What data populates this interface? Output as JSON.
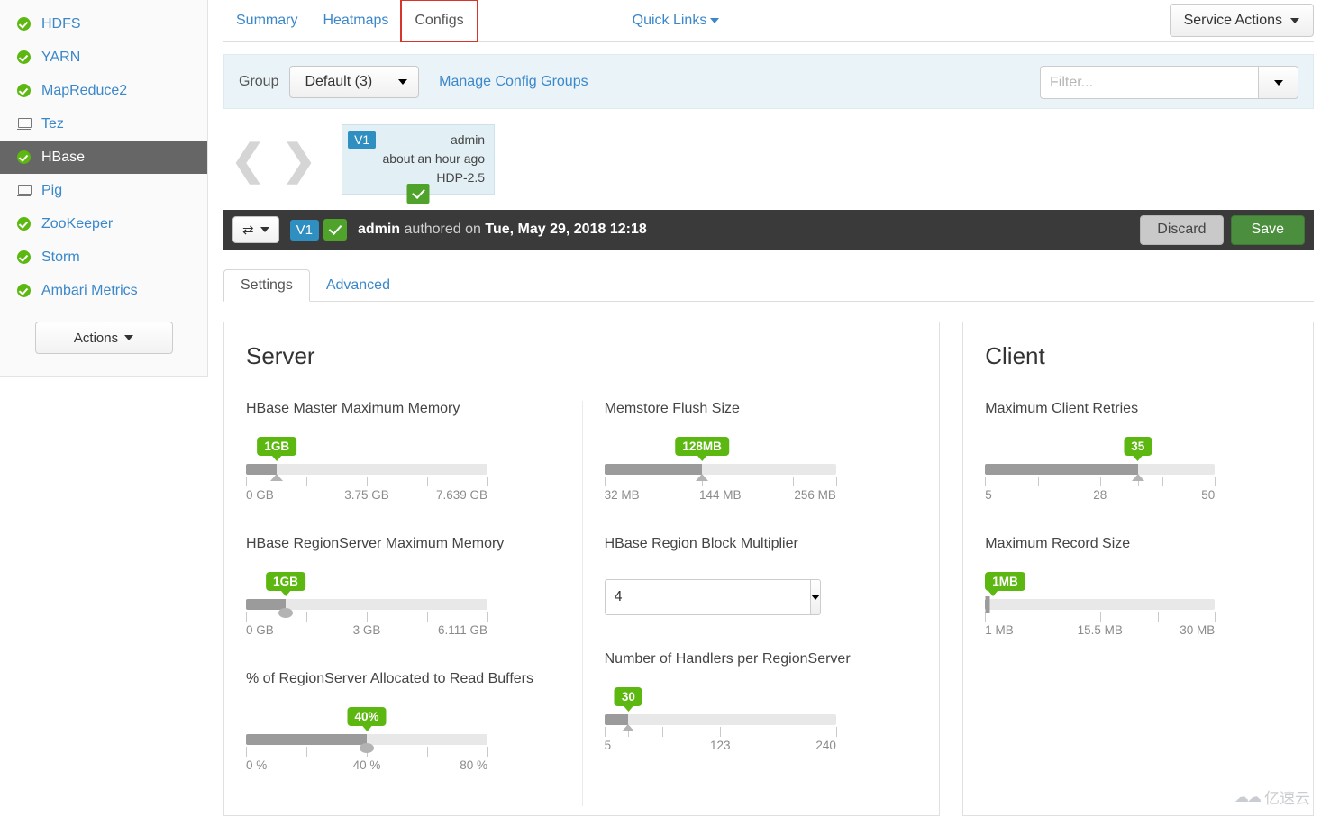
{
  "sidebar": {
    "services": [
      {
        "label": "HDFS",
        "icon": "status-ok-icon",
        "status": "ok",
        "active": false
      },
      {
        "label": "YARN",
        "icon": "status-ok-icon",
        "status": "ok",
        "active": false
      },
      {
        "label": "MapReduce2",
        "icon": "status-ok-icon",
        "status": "ok",
        "active": false
      },
      {
        "label": "Tez",
        "icon": "client-monitor-icon",
        "status": "client",
        "active": false
      },
      {
        "label": "HBase",
        "icon": "status-ok-icon",
        "status": "ok",
        "active": true
      },
      {
        "label": "Pig",
        "icon": "client-monitor-icon",
        "status": "client",
        "active": false
      },
      {
        "label": "ZooKeeper",
        "icon": "status-ok-icon",
        "status": "ok",
        "active": false
      },
      {
        "label": "Storm",
        "icon": "status-ok-icon",
        "status": "ok",
        "active": false
      },
      {
        "label": "Ambari Metrics",
        "icon": "status-ok-icon",
        "status": "ok",
        "active": false
      }
    ],
    "actions_button": "Actions"
  },
  "header": {
    "tabs": [
      {
        "label": "Summary",
        "selected": false
      },
      {
        "label": "Heatmaps",
        "selected": false
      },
      {
        "label": "Configs",
        "selected": true,
        "annotated": true
      }
    ],
    "quick_links": "Quick Links",
    "service_actions": "Service Actions"
  },
  "group_bar": {
    "group_label": "Group",
    "group_value": "Default (3)",
    "manage_link": "Manage Config Groups",
    "filter_placeholder": "Filter...",
    "filter_value": ""
  },
  "version_card": {
    "badge": "V1",
    "author": "admin",
    "time": "about an hour ago",
    "stack": "HDP-2.5",
    "current_icon": "check-icon"
  },
  "version_bar": {
    "compare_icon": "shuffle-icon",
    "badge": "V1",
    "check_icon": "check-icon",
    "author": "admin",
    "authored_text": "authored on",
    "timestamp": "Tue, May 29, 2018 12:18",
    "discard_label": "Discard",
    "save_label": "Save"
  },
  "config_tabs": [
    {
      "label": "Settings",
      "selected": true
    },
    {
      "label": "Advanced",
      "selected": false
    }
  ],
  "panels": {
    "server": {
      "title": "Server",
      "left_fields": [
        {
          "label": "HBase Master Maximum Memory",
          "type": "slider",
          "value_label": "1GB",
          "value_pct": 12.8,
          "handle": "triangle",
          "track_width_pct": 100,
          "tick_pcts": [
            0,
            25,
            50,
            75,
            100
          ],
          "tick_labels": {
            "start": "0 GB",
            "mid": "3.75 GB",
            "end": "7.639 GB"
          }
        },
        {
          "label": "HBase RegionServer Maximum Memory",
          "type": "slider",
          "value_label": "1GB",
          "value_pct": 16.4,
          "handle": "round",
          "track_width_pct": 100,
          "tick_pcts": [
            0,
            25,
            50,
            75,
            100
          ],
          "tick_labels": {
            "start": "0 GB",
            "mid": "3 GB",
            "end": "6.111 GB"
          }
        },
        {
          "label": "% of RegionServer Allocated to Read Buffers",
          "type": "slider",
          "value_label": "40%",
          "value_pct": 50,
          "handle": "round",
          "track_width_pct": 100,
          "tick_pcts": [
            0,
            25,
            50,
            75,
            100
          ],
          "tick_labels": {
            "start": "0 %",
            "mid": "40 %",
            "end": "80 %"
          }
        }
      ],
      "right_fields": [
        {
          "label": "Memstore Flush Size",
          "type": "slider",
          "value_label": "128MB",
          "value_pct": 40.5,
          "handle": "triangle",
          "track_width_pct": 96,
          "tick_pcts": [
            0,
            23,
            40.5,
            57,
            78,
            96
          ],
          "tick_labels": {
            "start": "32 MB",
            "mid": "144 MB",
            "end": "256 MB"
          }
        },
        {
          "label": "HBase Region Block Multiplier",
          "type": "combo",
          "value": "4"
        },
        {
          "label": "Number of Handlers per RegionServer",
          "type": "slider",
          "value_label": "30",
          "value_pct": 10,
          "handle": "triangle",
          "track_width_pct": 96,
          "tick_pcts": [
            0,
            10,
            24,
            48,
            72,
            96
          ],
          "tick_labels": {
            "start": "5",
            "mid": "123",
            "end": "240"
          }
        }
      ]
    },
    "client": {
      "title": "Client",
      "fields": [
        {
          "label": "Maximum Client Retries",
          "type": "slider",
          "value_label": "35",
          "value_pct": 66.5,
          "handle": "triangle",
          "track_width_pct": 100,
          "tick_pcts": [
            0,
            23,
            50,
            66.5,
            77,
            100
          ],
          "tick_labels": {
            "start": "5",
            "mid": "28",
            "end": "50"
          }
        },
        {
          "label": "Maximum Record Size",
          "type": "slider",
          "value_label": "1MB",
          "value_pct": 1,
          "handle": "bar",
          "track_width_pct": 100,
          "tick_pcts": [
            0,
            25,
            50,
            75,
            100
          ],
          "tick_labels": {
            "start": "1 MB",
            "mid": "15.5 MB",
            "end": "30 MB"
          }
        }
      ]
    }
  },
  "watermark": {
    "text": "亿速云",
    "icon": "cloud-icon"
  },
  "colors": {
    "accent_link": "#3a87c9",
    "status_ok": "#5cb811",
    "save_green": "#4b8f3e",
    "version_badge": "#2e8fc0",
    "dark_bar": "#3a3a3a",
    "annotation_red": "#d9342b"
  }
}
